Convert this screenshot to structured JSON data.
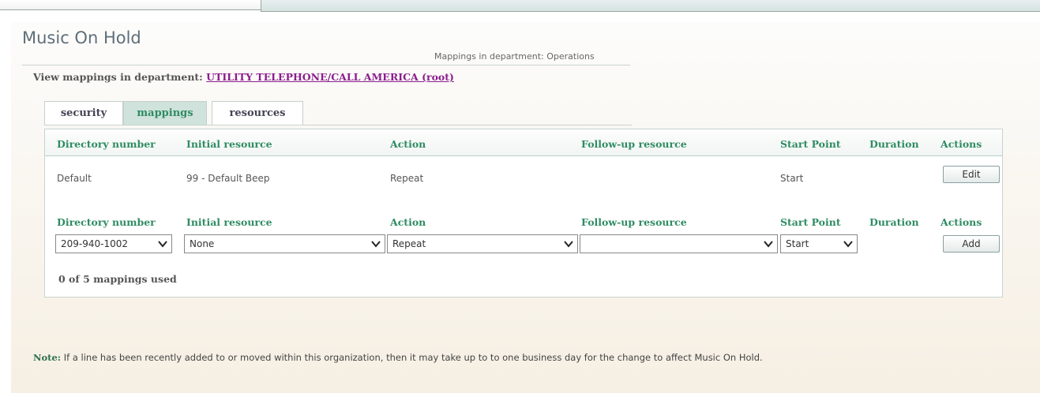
{
  "page": {
    "title": "Music On Hold",
    "subtitle": "Mappings in department: Operations",
    "view_label": "View mappings in department:",
    "view_link": "UTILITY TELEPHONE/CALL AMERICA (root)"
  },
  "tabs": [
    {
      "label": "security",
      "active": false
    },
    {
      "label": "mappings",
      "active": true
    },
    {
      "label": "resources",
      "active": false
    }
  ],
  "table": {
    "columns": [
      "Directory number",
      "Initial resource",
      "Action",
      "Follow-up resource",
      "Start Point",
      "Duration",
      "Actions"
    ],
    "rows": [
      {
        "directory_number": "Default",
        "initial_resource": "99 - Default Beep",
        "action": "Repeat",
        "followup_resource": "",
        "start_point": "Start",
        "duration": "",
        "button": "Edit"
      }
    ]
  },
  "add_form": {
    "columns": [
      "Directory number",
      "Initial resource",
      "Action",
      "Follow-up resource",
      "Start Point",
      "Duration",
      "Actions"
    ],
    "directory_number": "209-940-1002",
    "initial_resource": "None",
    "action": "Repeat",
    "followup_resource": "",
    "start_point": "Start",
    "button": "Add"
  },
  "usage_text": "0 of 5 mappings used",
  "note": {
    "label": "Note:",
    "text": " If a line has been recently added to or moved within this organization, then it may take up to to one business day for the change to affect Music On Hold."
  },
  "colors": {
    "accent_green": "#2f8c63",
    "link_purple": "#8b1e8e",
    "title_gray": "#5e6f7a"
  }
}
